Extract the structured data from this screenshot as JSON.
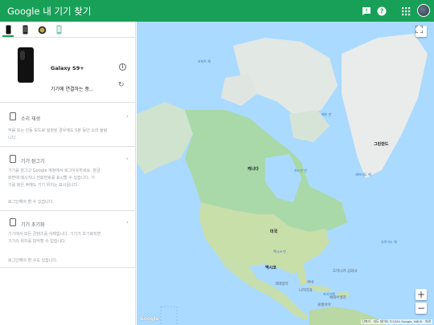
{
  "header": {
    "title": "Google 내 기기 찾기",
    "brand_color": "#18a058"
  },
  "device_tabs": [
    "phone-icon",
    "phone-icon",
    "watch-icon",
    "phone-icon"
  ],
  "device": {
    "name": "Galaxy S9+",
    "status": "기기에 연결하는 중..."
  },
  "actions": [
    {
      "title": "소리 재생",
      "description": "무음 또는 진동 모드로 설정된 경우에도 5분 동안 소리 울림",
      "description2": "니다.",
      "note": ""
    },
    {
      "title": "기기 잠그기",
      "description": "기기를 잠그고 Google 계정에서 로그아웃하세요. 잠금",
      "description2": "화면에 메시지나 전화번호를 표시할 수 있습니다. 기",
      "description3": "기를 찾은 후에도 기기 위치는 표시됩니다.",
      "note": "로그인해야 할 수 있습니다."
    },
    {
      "title": "기기 초기화",
      "description": "기기에서 모든 콘텐츠를 삭제합니다. 기기가 초기화되면",
      "description2": "기기의 위치를 파악할 수 없습니다.",
      "description3": "",
      "note": "로그인해야 할 수도 있습니다."
    }
  ],
  "map": {
    "labels": {
      "greenland": "그린란드",
      "canada": "캐나다",
      "usa": "미국",
      "mexico": "멕시코",
      "cuba": "쿠바",
      "guatemala": "과테말라",
      "nicaragua": "니카라과",
      "dominican": "도미니카 공화국",
      "venezuela": "베네수엘라",
      "colombia": "콜롬비아",
      "hudson_bay": "허드슨 만",
      "labrador_sea": "래브라도 해",
      "baffin_bay": "배핀 만",
      "beaufort_sea": "보퍼트 해",
      "gulf_of_mexico": "멕시코 만",
      "sargasso": "사르가소 해",
      "caribbean": "카리브해"
    },
    "google_logo": "Google",
    "attribution": "단축키 · 지도 데이터 ©2020 Google, INEGI · 약관"
  }
}
